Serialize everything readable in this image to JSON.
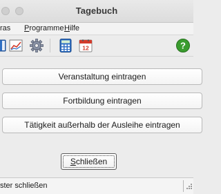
{
  "window": {
    "title": "Tagebuch"
  },
  "menu": {
    "items": [
      {
        "pre": "",
        "mnemonic": "",
        "post": "ras"
      },
      {
        "pre": "",
        "mnemonic": "P",
        "post": "rogramme"
      },
      {
        "pre": "",
        "mnemonic": "H",
        "post": "ilfe"
      }
    ]
  },
  "toolbar": {
    "icons": [
      "book-icon",
      "chart-icon",
      "gear-icon",
      "calculator-icon",
      "calendar-icon",
      "help-icon"
    ],
    "calendar_day": "12",
    "help_glyph": "?"
  },
  "actions": {
    "veranstaltung": "Veranstaltung eintragen",
    "fortbildung": "Fortbildung eintragen",
    "taetigkeit": "Tätigkeit außerhalb der Ausleihe eintragen"
  },
  "close_button": {
    "pre": "",
    "mnemonic": "S",
    "post": "chließen"
  },
  "status": {
    "text": "ster schließen"
  },
  "colors": {
    "help_green": "#3a9c2e",
    "calendar_red": "#d23b2b",
    "calculator_blue": "#2f6fc4"
  }
}
